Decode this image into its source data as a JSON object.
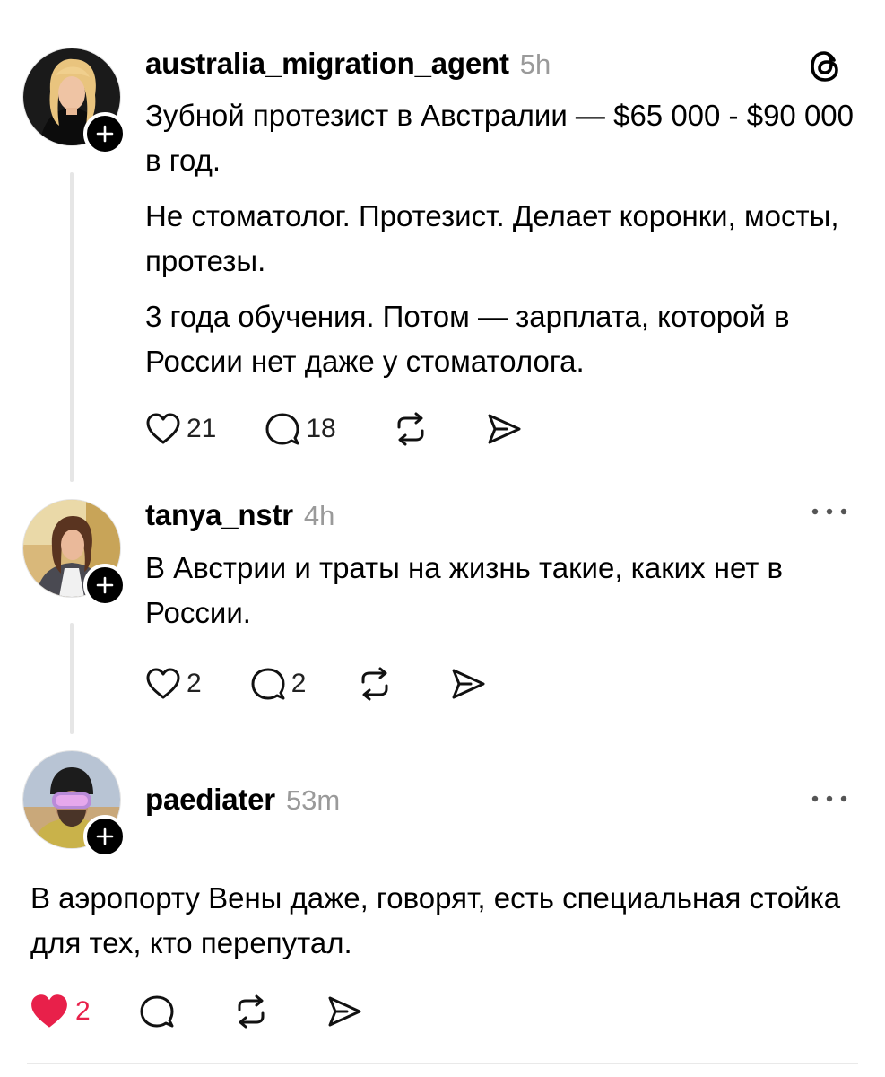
{
  "posts": [
    {
      "username": "australia_migration_agent",
      "time": "5h",
      "paragraphs": [
        "Зубной протезист в Австралии — $65 000 - $90 000 в год.",
        "Не стоматолог. Протезист. Делает коронки, мосты, протезы.",
        "3 года обучения. Потом — зарплата, которой в России нет даже у стоматолога."
      ],
      "likes": "21",
      "replies": "18",
      "liked": false
    },
    {
      "username": "tanya_nstr",
      "time": "4h",
      "paragraphs": [
        "В Австрии и траты на жизнь такие, каких нет в России."
      ],
      "likes": "2",
      "replies": "2",
      "liked": false
    },
    {
      "username": "paediater",
      "time": "53m",
      "paragraphs": [
        "В аэропорту Вены даже, говорят, есть специальная стойка для тех, кто перепутал."
      ],
      "likes": "2",
      "replies": "",
      "liked": true
    }
  ],
  "icons": {
    "app_logo": "threads-logo-icon",
    "like": "heart-icon",
    "reply": "comment-icon",
    "repost": "repost-icon",
    "share": "share-icon",
    "more": "more-icon",
    "follow": "plus-icon"
  },
  "colors": {
    "liked": "#e8204a",
    "muted": "#9a9a9a",
    "line": "#e6e6e6"
  }
}
